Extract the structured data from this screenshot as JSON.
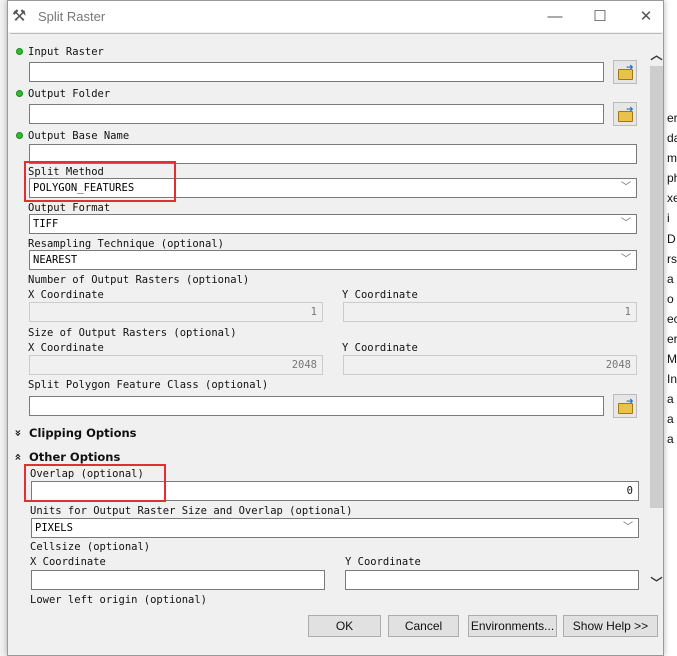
{
  "window": {
    "title": "Split Raster",
    "minimize": "—",
    "maximize": "☐",
    "close": "✕"
  },
  "background": {
    "fragments": [
      "er",
      "da",
      "m",
      "ph",
      "xe",
      "i",
      "D",
      "rs",
      "a",
      "o",
      "ec",
      "er",
      "Mo",
      "In",
      "a",
      "a",
      "a"
    ]
  },
  "fields": {
    "input_raster": {
      "label": "Input Raster",
      "value": ""
    },
    "output_folder": {
      "label": "Output Folder",
      "value": ""
    },
    "output_base_name": {
      "label": "Output Base Name",
      "value": ""
    },
    "split_method": {
      "label": "Split Method",
      "value": "POLYGON_FEATURES"
    },
    "output_format": {
      "label": "Output Format",
      "value": "TIFF"
    },
    "resampling": {
      "label": "Resampling Technique (optional)",
      "value": "NEAREST"
    },
    "num_output": {
      "label": "Number of Output Rasters (optional)",
      "x_label": "X Coordinate",
      "y_label": "Y Coordinate",
      "x_value": "1",
      "y_value": "1"
    },
    "size_output": {
      "label": "Size of Output Rasters (optional)",
      "x_label": "X Coordinate",
      "y_label": "Y Coordinate",
      "x_value": "2048",
      "y_value": "2048"
    },
    "split_polygon": {
      "label": "Split Polygon Feature Class (optional)",
      "value": ""
    },
    "overlap": {
      "label": "Overlap (optional)",
      "value": "0"
    },
    "units": {
      "label": "Units for Output Raster Size and Overlap (optional)",
      "value": "PIXELS"
    },
    "cellsize": {
      "label": "Cellsize (optional)",
      "x_label": "X Coordinate",
      "y_label": "Y Coordinate",
      "x_value": "",
      "y_value": ""
    },
    "lower_left": {
      "label": "Lower left origin (optional)"
    }
  },
  "sections": {
    "clipping": {
      "label": "Clipping Options",
      "icon": "double-chevron-down"
    },
    "other": {
      "label": "Other Options",
      "icon": "double-chevron-up"
    }
  },
  "buttons": {
    "ok": "OK",
    "cancel": "Cancel",
    "environments": "Environments...",
    "show_help": "Show Help >>"
  },
  "colors": {
    "highlight": "#e03030",
    "required_dot": "#2bbf2b"
  }
}
